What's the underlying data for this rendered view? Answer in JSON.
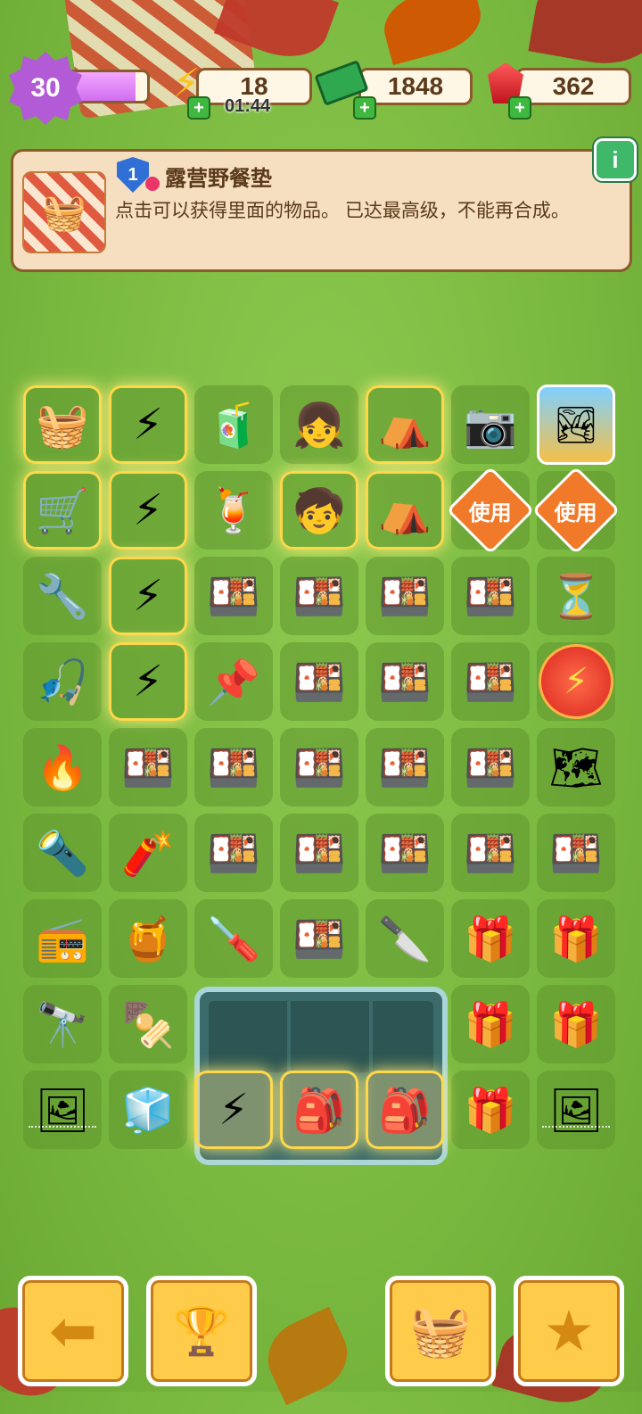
{
  "hud": {
    "level": "30",
    "xp_fill_ratio": 0.85,
    "energy": "18",
    "energy_timer": "01:44",
    "cash": "1848",
    "gems": "362",
    "icons": [
      "energy-bolt-icon",
      "cash-stack-icon",
      "ruby-gem-icon"
    ]
  },
  "info": {
    "item_level": "1",
    "title": "露营野餐垫",
    "description": "点击可以获得里面的物品。 已达最高级，不能再合成。",
    "info_button": "i"
  },
  "board": {
    "rows": [
      [
        "picnic-mat",
        "energy-bag",
        "juice-bottle",
        "camper-girl",
        "tent-bundle",
        "camera-guy",
        "scenery-card"
      ],
      [
        "lunch-cart",
        "energy-bag",
        "juice-pitcher",
        "cloud-hat-kid",
        "tent-bundle",
        "use",
        "use"
      ],
      [
        "tools",
        "energy-bag",
        "lunchbox",
        "lunchbox",
        "lunchbox",
        "lunchbox",
        "hourglass-card"
      ],
      [
        "fishing-gear",
        "energy-bag-small",
        "nail",
        "lunchbox",
        "lunchbox",
        "lunchbox",
        "energy-orb"
      ],
      [
        "grill-stand",
        "lunchbox",
        "lunchbox",
        "lunchbox",
        "lunchbox-big",
        "lunchbox",
        "map-scroll"
      ],
      [
        "flashlight",
        "matchbox",
        "lunchbox",
        "lunchbox",
        "lunchbox",
        "lunchbox-big",
        "lunchbox"
      ],
      [
        "radio",
        "honey-jar",
        "screwdriver",
        "lunchbox",
        "pocket-knife",
        "treasure-chest",
        "treasure-chest"
      ],
      [
        "telescope",
        "kebab",
        "",
        "",
        "",
        "treasure-chest",
        "treasure-chest-bolt"
      ],
      [
        "photo-frame",
        "cooler-box",
        "",
        "",
        "",
        "treasure-chest",
        "photo-frame"
      ]
    ],
    "use_label": "使用"
  },
  "bottom": {
    "buttons": [
      "back-arrow-icon",
      "podium-icon",
      "basket-icon",
      "star-clipboard-icon"
    ]
  }
}
